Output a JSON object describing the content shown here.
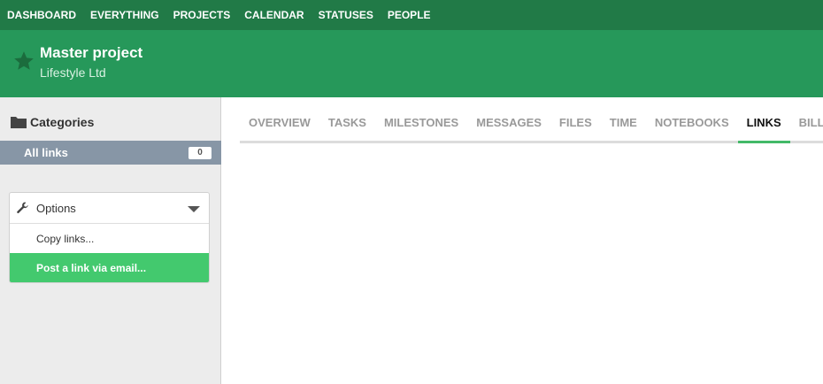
{
  "topnav": {
    "items": [
      "DASHBOARD",
      "EVERYTHING",
      "PROJECTS",
      "CALENDAR",
      "STATUSES",
      "PEOPLE"
    ]
  },
  "project": {
    "title": "Master project",
    "company": "Lifestyle Ltd",
    "star_icon": "star-icon"
  },
  "sidebar": {
    "categories_title": "Categories",
    "all_links_label": "All links",
    "all_links_count": "0",
    "options_title": "Options",
    "options_items": [
      "Copy links...",
      "Post a link via email..."
    ]
  },
  "tabs": {
    "items": [
      "OVERVIEW",
      "TASKS",
      "MILESTONES",
      "MESSAGES",
      "FILES",
      "TIME",
      "NOTEBOOKS",
      "LINKS",
      "BILLING"
    ],
    "active": "LINKS"
  },
  "colors": {
    "topnav_bg": "#217a47",
    "header_bg": "#26985a",
    "selected_category": "#8796a6",
    "active_option": "#43c96e",
    "tab_underline": "#43b968"
  }
}
